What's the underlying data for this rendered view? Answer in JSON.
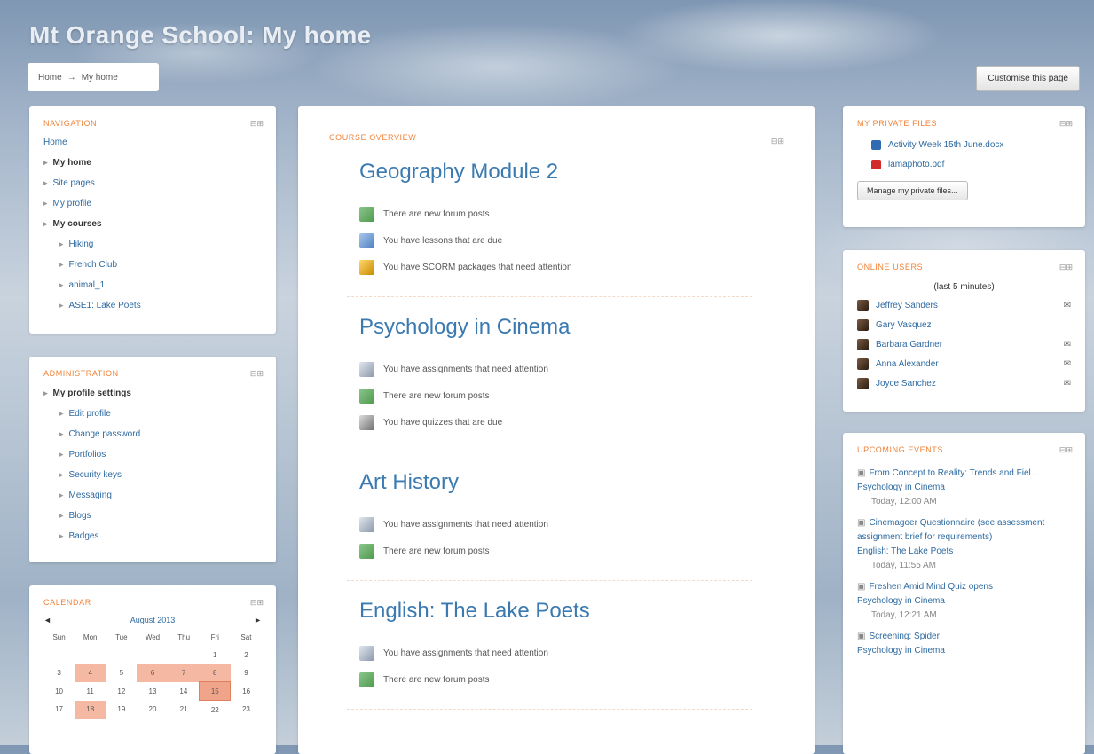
{
  "site": {
    "title": "Mt Orange School: My home",
    "breadcrumb": [
      "Home",
      "My home"
    ],
    "customise_button": "Customise this page"
  },
  "navigation": {
    "title": "NAVIGATION",
    "items": [
      {
        "label": "Home",
        "level": 0,
        "bold": false,
        "bullet": false
      },
      {
        "label": "My home",
        "level": 0,
        "bold": true,
        "bullet": true
      },
      {
        "label": "Site pages",
        "level": 0,
        "bold": false,
        "bullet": true
      },
      {
        "label": "My profile",
        "level": 0,
        "bold": false,
        "bullet": true
      },
      {
        "label": "My courses",
        "level": 0,
        "bold": true,
        "bullet": true
      },
      {
        "label": "Hiking",
        "level": 1,
        "bold": false,
        "bullet": true
      },
      {
        "label": "French Club",
        "level": 1,
        "bold": false,
        "bullet": true
      },
      {
        "label": "animal_1",
        "level": 1,
        "bold": false,
        "bullet": true
      },
      {
        "label": "ASE1: Lake Poets",
        "level": 1,
        "bold": false,
        "bullet": true
      }
    ]
  },
  "administration": {
    "title": "ADMINISTRATION",
    "items": [
      {
        "label": "My profile settings",
        "level": 0,
        "bold": true
      },
      {
        "label": "Edit profile",
        "level": 1,
        "bold": false
      },
      {
        "label": "Change password",
        "level": 1,
        "bold": false
      },
      {
        "label": "Portfolios",
        "level": 1,
        "bold": false
      },
      {
        "label": "Security keys",
        "level": 1,
        "bold": false
      },
      {
        "label": "Messaging",
        "level": 1,
        "bold": false
      },
      {
        "label": "Blogs",
        "level": 1,
        "bold": false
      },
      {
        "label": "Badges",
        "level": 1,
        "bold": false
      }
    ]
  },
  "calendar": {
    "title": "CALENDAR",
    "month": "August 2013",
    "weekdays": [
      "Sun",
      "Mon",
      "Tue",
      "Wed",
      "Thu",
      "Fri",
      "Sat"
    ],
    "weeks": [
      [
        "",
        "",
        "",
        "",
        "",
        "1",
        "2"
      ],
      [
        "3",
        "4",
        "5",
        "6",
        "7",
        "8",
        "9"
      ],
      [
        "10",
        "11",
        "12",
        "13",
        "14",
        "15",
        "16"
      ],
      [
        "17",
        "18",
        "19",
        "20",
        "21",
        "22",
        "23"
      ]
    ],
    "event_days": [
      "4",
      "6",
      "7",
      "8",
      "18"
    ],
    "today": "15"
  },
  "course_overview": {
    "title": "COURSE OVERVIEW",
    "courses": [
      {
        "name": "Geography Module 2",
        "items": [
          {
            "icon": "forum",
            "text": "There are new forum posts"
          },
          {
            "icon": "lesson",
            "text": "You have lessons that are due"
          },
          {
            "icon": "scorm",
            "text": "You have SCORM packages that need attention"
          }
        ]
      },
      {
        "name": "Psychology in Cinema",
        "items": [
          {
            "icon": "assign",
            "text": "You have assignments that need attention"
          },
          {
            "icon": "forum",
            "text": "There are new forum posts"
          },
          {
            "icon": "quiz",
            "text": "You have quizzes that are due"
          }
        ]
      },
      {
        "name": "Art History",
        "items": [
          {
            "icon": "assign",
            "text": "You have assignments that need attention"
          },
          {
            "icon": "forum",
            "text": "There are new forum posts"
          }
        ]
      },
      {
        "name": "English: The Lake Poets",
        "items": [
          {
            "icon": "assign",
            "text": "You have assignments that need attention"
          },
          {
            "icon": "forum",
            "text": "There are new forum posts"
          }
        ]
      }
    ]
  },
  "private_files": {
    "title": "MY PRIVATE FILES",
    "files": [
      {
        "name": "Activity Week 15th June.docx",
        "color": "#2e6bb3"
      },
      {
        "name": "lamaphoto.pdf",
        "color": "#d22b2b"
      }
    ],
    "manage_button": "Manage my private files..."
  },
  "online_users": {
    "title": "ONLINE USERS",
    "subtitle": "(last 5 minutes)",
    "users": [
      {
        "name": "Jeffrey Sanders",
        "msg": true
      },
      {
        "name": "Gary Vasquez",
        "msg": false
      },
      {
        "name": "Barbara Gardner",
        "msg": true
      },
      {
        "name": "Anna Alexander",
        "msg": true
      },
      {
        "name": "Joyce Sanchez",
        "msg": true
      }
    ]
  },
  "upcoming_events": {
    "title": "UPCOMING EVENTS",
    "events": [
      {
        "name": "From Concept to Reality: Trends and Fiel...",
        "course": "Psychology in Cinema",
        "time": "Today, 12:00 AM"
      },
      {
        "name": "Cinemagoer Questionnaire (see assessment assignment brief for requirements)",
        "course": "English: The Lake Poets",
        "time": "Today, 11:55 AM"
      },
      {
        "name": "Freshen Amid Mind Quiz opens",
        "course": "Psychology in Cinema",
        "time": "Today, 12:21 AM"
      },
      {
        "name": "Screening: Spider",
        "course": "Psychology in Cinema",
        "time": ""
      }
    ]
  }
}
